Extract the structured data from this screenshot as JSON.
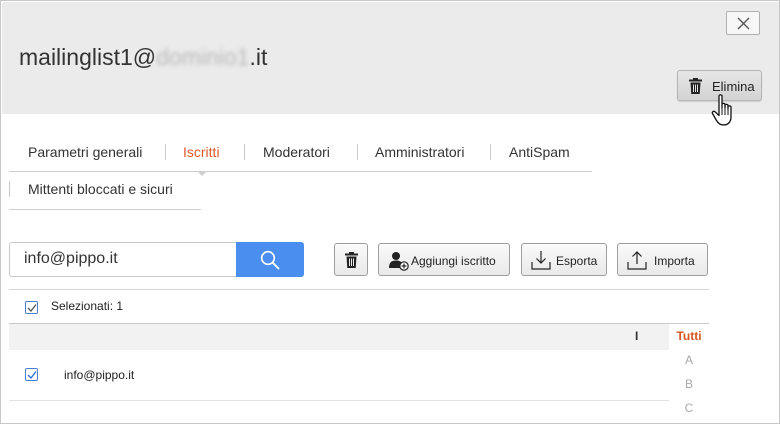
{
  "header": {
    "title_prefix": "mailinglist1@",
    "title_blurred": "dominio1",
    "title_suffix": ".it",
    "close_icon": "close-icon",
    "delete_label": "Elimina"
  },
  "tabs": [
    {
      "label": "Parametri generali",
      "active": false
    },
    {
      "label": "Iscritti",
      "active": true
    },
    {
      "label": "Moderatori",
      "active": false
    },
    {
      "label": "Amministratori",
      "active": false
    },
    {
      "label": "AntiSpam",
      "active": false
    },
    {
      "label": "Mittenti bloccati e sicuri",
      "active": false
    }
  ],
  "search": {
    "value": "info@pippo.it"
  },
  "toolbar": {
    "add_label": "Aggiungi iscritto",
    "export_label": "Esporta",
    "import_label": "Importa"
  },
  "selection": {
    "label": "Selezionati: 1",
    "checked": true
  },
  "list": {
    "column_header": "I",
    "rows": [
      {
        "email": "info@pippo.it",
        "checked": true
      }
    ]
  },
  "alphabet": [
    "Tutti",
    "A",
    "B",
    "C"
  ],
  "colors": {
    "accent": "#e05a2b",
    "search_button": "#4a8ff0"
  }
}
